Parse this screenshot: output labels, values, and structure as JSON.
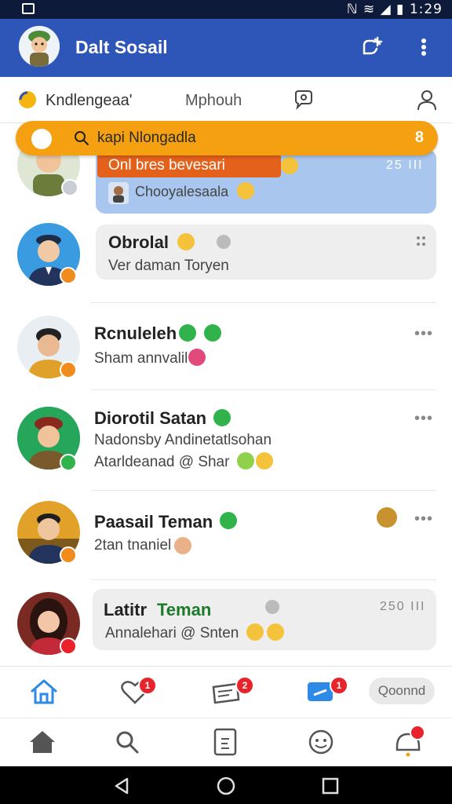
{
  "status_bar": {
    "time": "1:29"
  },
  "app": {
    "title": "Dalt Sosail"
  },
  "tabs": [
    {
      "label": "Kndlengeaa'"
    },
    {
      "label": "Mphouh"
    }
  ],
  "search": {
    "text": "kapi Nlongadla",
    "count": "8"
  },
  "chats": [
    {
      "name": "Onl bres bevesari",
      "preview": "Chooyalesaala",
      "meta": "25 III"
    },
    {
      "name": "Obrolal",
      "preview": "Ver daman Toryen"
    },
    {
      "name": "Rcnuleleh",
      "preview": "Sham annvalil"
    },
    {
      "name": "Diorotil Satan",
      "preview": "Nadonsby Andinetatlsohan",
      "preview2": "Atarldeanad @ Shar"
    },
    {
      "name": "Paasail Teman",
      "preview": "2tan tnaniel"
    },
    {
      "name": "Latitr",
      "name_green": "Teman",
      "preview": "Annalehari @ Snten",
      "meta": "250 III"
    }
  ],
  "bottom_nav": {
    "badges": [
      "1",
      "2",
      "1"
    ],
    "chip_label": "Qoonnd"
  },
  "colors": {
    "appbar": "#2d56b8",
    "accent": "#f4a010",
    "bubble_blue": "#a8c6ee",
    "online": "#2fb34a"
  }
}
